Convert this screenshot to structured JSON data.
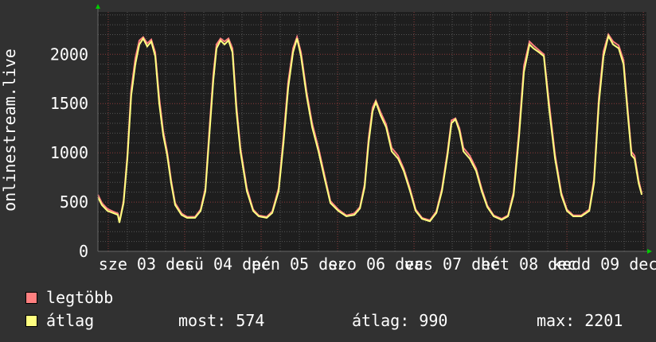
{
  "chart_data": {
    "type": "line",
    "ylabel": "onlinestream.live",
    "x_unit": "day of December",
    "xlim": [
      2.865,
      10.04
    ],
    "ylim": [
      0,
      2430
    ],
    "y_ticks": [
      0,
      500,
      1000,
      1500,
      2000
    ],
    "x_ticks": [
      {
        "day": 3.5,
        "label": "sze 03 dec"
      },
      {
        "day": 4.5,
        "label": "csü 04 dec"
      },
      {
        "day": 5.5,
        "label": "pén 05 dec"
      },
      {
        "day": 6.5,
        "label": "szo 06 dec"
      },
      {
        "day": 7.5,
        "label": "vas 07 dec"
      },
      {
        "day": 8.5,
        "label": "hét 08 dec"
      },
      {
        "day": 9.5,
        "label": "kedd 09 dec"
      }
    ],
    "grid": true,
    "background": "#1e1e1e",
    "series": [
      {
        "name": "legtöbb",
        "color": "#ff8080"
      },
      {
        "name": "átlag",
        "color": "#ffff80"
      }
    ],
    "points_day_avg_max": [
      [
        2.865,
        550,
        575
      ],
      [
        2.917,
        470,
        490
      ],
      [
        2.99,
        410,
        430
      ],
      [
        3.06,
        390,
        405
      ],
      [
        3.125,
        370,
        385
      ],
      [
        3.146,
        290,
        300
      ],
      [
        3.2,
        490,
        510
      ],
      [
        3.25,
        940,
        980
      ],
      [
        3.3,
        1580,
        1640
      ],
      [
        3.354,
        1900,
        1960
      ],
      [
        3.406,
        2100,
        2140
      ],
      [
        3.458,
        2160,
        2175
      ],
      [
        3.51,
        2080,
        2110
      ],
      [
        3.5625,
        2130,
        2150
      ],
      [
        3.615,
        1980,
        2020
      ],
      [
        3.667,
        1500,
        1560
      ],
      [
        3.719,
        1180,
        1220
      ],
      [
        3.771,
        975,
        1010
      ],
      [
        3.823,
        690,
        720
      ],
      [
        3.875,
        470,
        490
      ],
      [
        3.958,
        370,
        385
      ],
      [
        4.031,
        340,
        350
      ],
      [
        4.135,
        340,
        350
      ],
      [
        4.208,
        410,
        425
      ],
      [
        4.271,
        610,
        640
      ],
      [
        4.323,
        1180,
        1240
      ],
      [
        4.375,
        1740,
        1800
      ],
      [
        4.417,
        2060,
        2100
      ],
      [
        4.469,
        2140,
        2160
      ],
      [
        4.521,
        2100,
        2130
      ],
      [
        4.573,
        2140,
        2160
      ],
      [
        4.625,
        2020,
        2060
      ],
      [
        4.677,
        1420,
        1480
      ],
      [
        4.729,
        1015,
        1050
      ],
      [
        4.813,
        610,
        640
      ],
      [
        4.896,
        410,
        425
      ],
      [
        4.969,
        355,
        365
      ],
      [
        5.073,
        340,
        350
      ],
      [
        5.146,
        390,
        405
      ],
      [
        5.229,
        610,
        640
      ],
      [
        5.292,
        1100,
        1160
      ],
      [
        5.354,
        1660,
        1720
      ],
      [
        5.417,
        2020,
        2060
      ],
      [
        5.469,
        2160,
        2175
      ],
      [
        5.521,
        1980,
        2020
      ],
      [
        5.594,
        1580,
        1620
      ],
      [
        5.667,
        1260,
        1300
      ],
      [
        5.75,
        1015,
        1050
      ],
      [
        5.833,
        730,
        760
      ],
      [
        5.906,
        490,
        510
      ],
      [
        6.01,
        410,
        425
      ],
      [
        6.115,
        355,
        365
      ],
      [
        6.219,
        370,
        385
      ],
      [
        6.292,
        435,
        450
      ],
      [
        6.354,
        650,
        680
      ],
      [
        6.406,
        1100,
        1150
      ],
      [
        6.458,
        1420,
        1460
      ],
      [
        6.5,
        1515,
        1530
      ],
      [
        6.5625,
        1380,
        1410
      ],
      [
        6.635,
        1260,
        1290
      ],
      [
        6.708,
        1015,
        1050
      ],
      [
        6.792,
        940,
        970
      ],
      [
        6.865,
        815,
        840
      ],
      [
        6.948,
        610,
        635
      ],
      [
        7.021,
        410,
        425
      ],
      [
        7.104,
        330,
        340
      ],
      [
        7.208,
        305,
        315
      ],
      [
        7.292,
        390,
        405
      ],
      [
        7.365,
        610,
        635
      ],
      [
        7.438,
        975,
        1010
      ],
      [
        7.49,
        1300,
        1330
      ],
      [
        7.542,
        1340,
        1350
      ],
      [
        7.594,
        1220,
        1250
      ],
      [
        7.646,
        1015,
        1050
      ],
      [
        7.729,
        940,
        970
      ],
      [
        7.813,
        815,
        840
      ],
      [
        7.885,
        610,
        635
      ],
      [
        7.958,
        450,
        465
      ],
      [
        8.042,
        355,
        365
      ],
      [
        8.146,
        320,
        330
      ],
      [
        8.229,
        355,
        365
      ],
      [
        8.302,
        570,
        600
      ],
      [
        8.375,
        1180,
        1240
      ],
      [
        8.4375,
        1820,
        1880
      ],
      [
        8.51,
        2100,
        2130
      ],
      [
        8.5625,
        2060,
        2090
      ],
      [
        8.635,
        2020,
        2040
      ],
      [
        8.698,
        1980,
        2000
      ],
      [
        8.771,
        1420,
        1480
      ],
      [
        8.844,
        940,
        980
      ],
      [
        8.927,
        570,
        595
      ],
      [
        9.0,
        410,
        425
      ],
      [
        9.083,
        355,
        365
      ],
      [
        9.1875,
        355,
        365
      ],
      [
        9.292,
        410,
        425
      ],
      [
        9.354,
        690,
        730
      ],
      [
        9.417,
        1500,
        1560
      ],
      [
        9.479,
        1980,
        2030
      ],
      [
        9.542,
        2185,
        2201
      ],
      [
        9.604,
        2100,
        2130
      ],
      [
        9.677,
        2060,
        2090
      ],
      [
        9.74,
        1900,
        1940
      ],
      [
        9.792,
        1420,
        1470
      ],
      [
        9.844,
        975,
        1010
      ],
      [
        9.885,
        940,
        970
      ],
      [
        9.938,
        690,
        720
      ],
      [
        9.979,
        574,
        590
      ]
    ]
  },
  "legend": {
    "items": [
      {
        "label": "legtöbb",
        "color": "#ff8080"
      },
      {
        "label": "átlag",
        "color": "#ffff80"
      }
    ],
    "stats": {
      "now": "most: 574",
      "avg": "átlag: 990",
      "max": "max: 2201"
    }
  }
}
